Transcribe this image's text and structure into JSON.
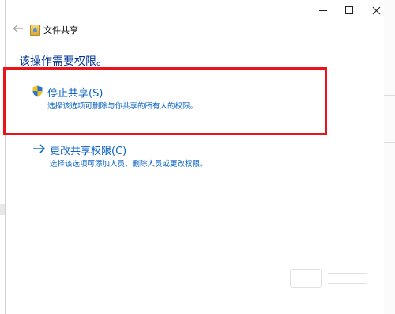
{
  "window": {
    "title": "文件共享",
    "instruction": "该操作需要权限。"
  },
  "options": [
    {
      "title": "停止共享(S)",
      "description": "选择该选项可删除与你共享的所有人的权限。",
      "icon": "shield-icon"
    },
    {
      "title": "更改共享权限(C)",
      "description": "选择该选项可添加人员、删除人员或更改权限。",
      "icon": "arrow-right-icon"
    }
  ],
  "colors": {
    "highlight_frame": "#e8141c",
    "link": "#0a63c6",
    "instruction": "#003399"
  }
}
